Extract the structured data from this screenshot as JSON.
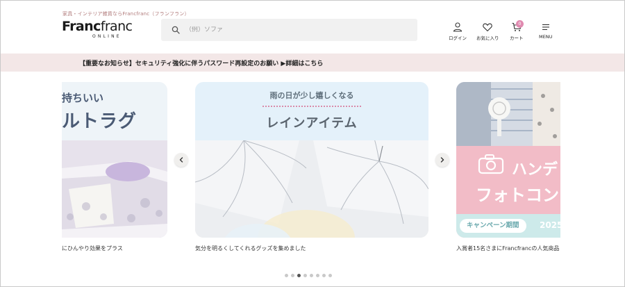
{
  "header": {
    "tagline": "家具・インテリア雑貨ならFrancfranc（フランフラン）",
    "logo_main_bold": "Franc",
    "logo_main_thin": "franc",
    "logo_sub": "ONLINE",
    "search_placeholder": "（例）ソファ",
    "icons": {
      "login_label": "ログイン",
      "favorites_label": "お気に入り",
      "cart_label": "カート",
      "cart_count": "0",
      "menu_label": "MENU"
    }
  },
  "notice": {
    "text": "【重要なお知らせ】セキュリティ強化に伴うパスワード再設定のお願い ▶詳細はこちら"
  },
  "carousel": {
    "slides": [
      {
        "title_line1": "持ちいい",
        "title_line2": "ルトラグ",
        "caption": "にひんやり効果をプラス"
      },
      {
        "title_line1": "雨の日が少し嬉しくなる",
        "title_line2": "レインアイテム",
        "caption": "気分を明るくしてくれるグッズを集めました"
      },
      {
        "title_line1": "ハンデ",
        "title_line2": "フォトコン",
        "pill": "キャンペーン期間",
        "year": "2025",
        "caption": "入賞者15名さまにFrancfrancの人気商品"
      }
    ],
    "dot_count": 8,
    "active_dot": 2,
    "colors": {
      "pink_panel": "#f2bcc7",
      "teal_panel": "#cdeaea",
      "notice_bg": "#f3e7e7",
      "accent_dots": "#d98aa8"
    }
  }
}
